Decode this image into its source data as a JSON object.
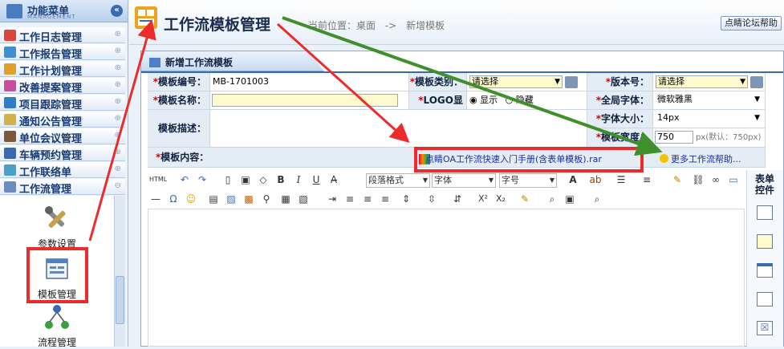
{
  "sidebar": {
    "title": "功能菜单",
    "subtitle": "MANAGEMENT",
    "collapse_label": "«",
    "items": [
      {
        "label": "工作日志管理"
      },
      {
        "label": "工作报告管理"
      },
      {
        "label": "工作计划管理"
      },
      {
        "label": "改善提案管理"
      },
      {
        "label": "项目跟踪管理"
      },
      {
        "label": "通知公告管理"
      },
      {
        "label": "单位会议管理"
      },
      {
        "label": "车辆预约管理"
      },
      {
        "label": "工作联络单"
      },
      {
        "label": "工作流管理"
      }
    ],
    "tools": [
      {
        "label": "参数设置"
      },
      {
        "label": "模板管理"
      },
      {
        "label": "流程管理"
      }
    ]
  },
  "header": {
    "title": "工作流模板管理",
    "breadcrumb_prefix": "当前位置：桌面",
    "breadcrumb_sep": "->",
    "breadcrumb_current": "新增模板",
    "help_button": "点睛论坛帮助"
  },
  "panel": {
    "tab_label": "新增工作流模板"
  },
  "form": {
    "template_no_label": "模板编号：",
    "template_no_value": "MB-1701003",
    "template_type_label": "模板类别：",
    "template_type_value": "请选择",
    "version_label": "版本号：",
    "version_value": "请选择",
    "template_name_label": "模板名称：",
    "template_name_value": "",
    "logo_label": "LOGO显示：",
    "logo_show": "显示",
    "logo_hide": "隐藏",
    "global_font_label": "全局字体：",
    "global_font_value": "微软雅黑",
    "desc_label": "模板描述：",
    "font_size_label": "字体大小：",
    "font_size_value": "14px",
    "width_label": "模板宽度：",
    "width_value": "750",
    "width_hint": "px(默认：750px)",
    "content_label": "模板内容："
  },
  "links": {
    "manual": "点睛OA工作流快速入门手册(含表单模板).rar",
    "more_help": "更多工作流帮助..."
  },
  "toolbar": {
    "paragraph": "段落格式",
    "font": "字体",
    "size": "字号"
  },
  "controls_title": "表单控件",
  "colors": {
    "highlight_red": "#ee2b2b",
    "arrow_green": "#3f8f2a",
    "accent_blue": "#3a6bb0"
  }
}
